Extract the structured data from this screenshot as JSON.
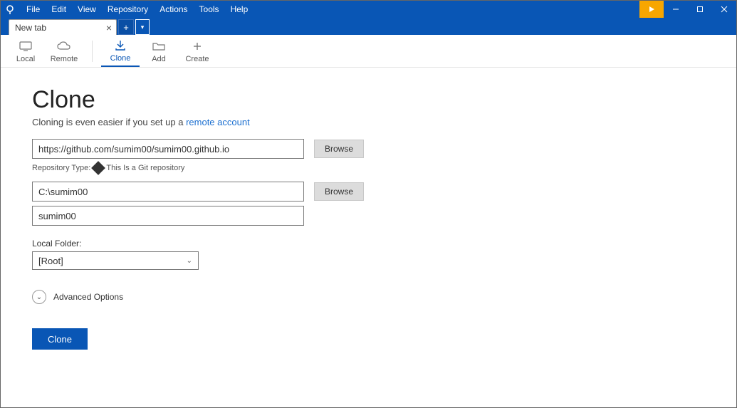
{
  "menubar": {
    "items": [
      "File",
      "Edit",
      "View",
      "Repository",
      "Actions",
      "Tools",
      "Help"
    ]
  },
  "tabbar": {
    "tab_label": "New tab"
  },
  "toolbar": {
    "local": "Local",
    "remote": "Remote",
    "clone": "Clone",
    "add": "Add",
    "create": "Create"
  },
  "content": {
    "title": "Clone",
    "subtitle_prefix": "Cloning is even easier if you set up a ",
    "subtitle_link": "remote account",
    "source_url": "https://github.com/sumim00/sumim00.github.io",
    "browse": "Browse",
    "repo_type_label": "Repository Type:",
    "repo_type_text": "This Is a Git repository",
    "dest_path": "C:\\sumim00",
    "name": "sumim00",
    "local_folder_label": "Local Folder:",
    "local_folder_value": "[Root]",
    "advanced": "Advanced Options",
    "clone_button": "Clone"
  }
}
